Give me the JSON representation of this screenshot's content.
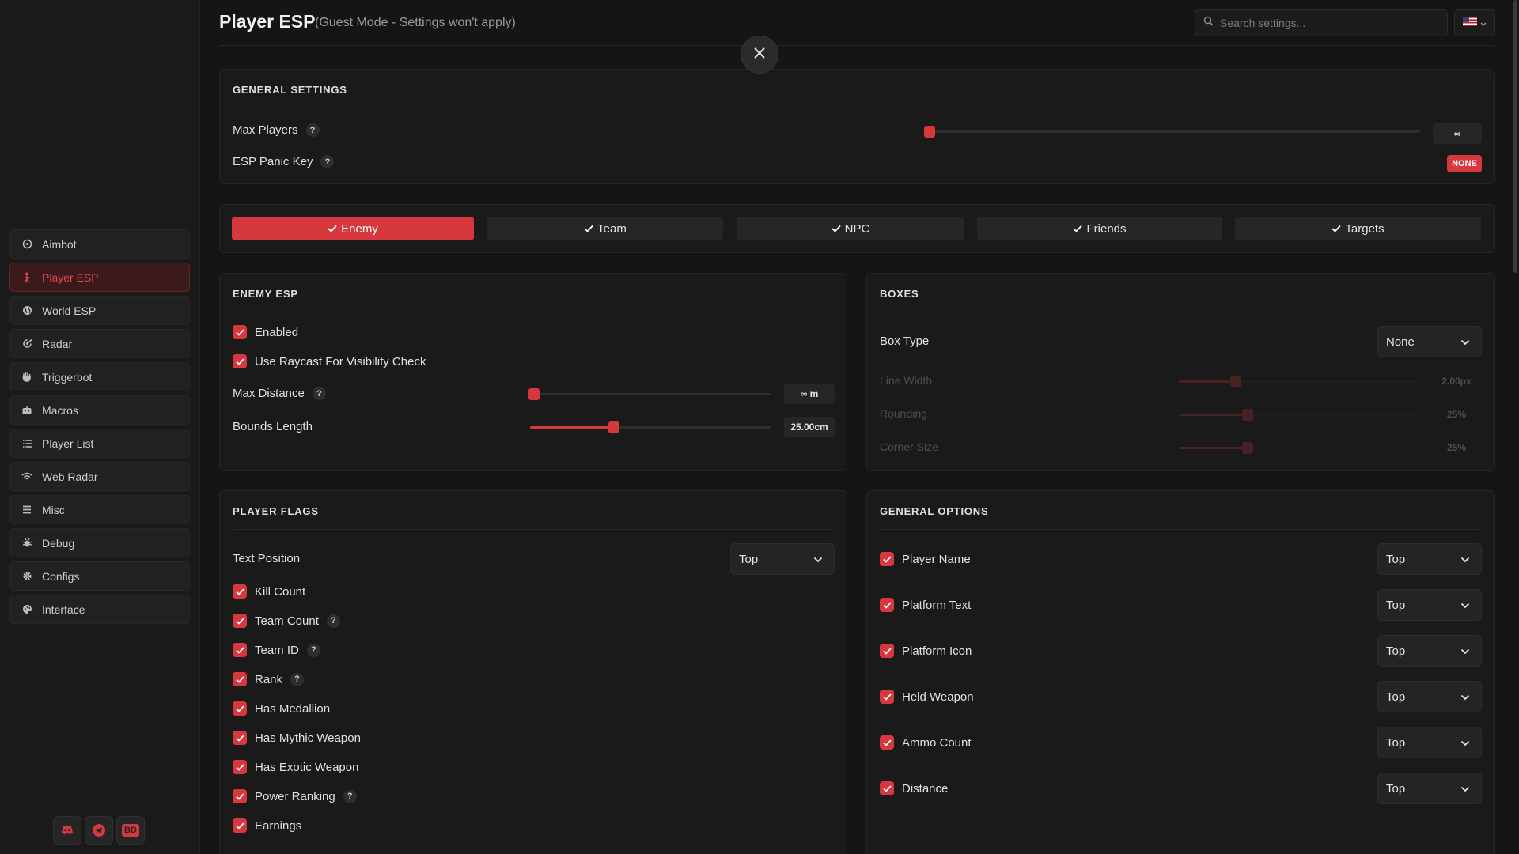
{
  "header": {
    "title": "Player ESP",
    "subtitle": "(Guest Mode - Settings won't apply)",
    "search_placeholder": "Search settings..."
  },
  "sidebar": {
    "items": [
      {
        "label": "Aimbot",
        "icon": "crosshair-icon",
        "active": false
      },
      {
        "label": "Player ESP",
        "icon": "person-icon",
        "active": true
      },
      {
        "label": "World ESP",
        "icon": "globe-icon",
        "active": false
      },
      {
        "label": "Radar",
        "icon": "radar-icon",
        "active": false
      },
      {
        "label": "Triggerbot",
        "icon": "hand-icon",
        "active": false
      },
      {
        "label": "Macros",
        "icon": "robot-icon",
        "active": false
      },
      {
        "label": "Player List",
        "icon": "list-icon",
        "active": false
      },
      {
        "label": "Web Radar",
        "icon": "wifi-icon",
        "active": false
      },
      {
        "label": "Misc",
        "icon": "menu-icon",
        "active": false
      },
      {
        "label": "Debug",
        "icon": "bug-icon",
        "active": false
      },
      {
        "label": "Configs",
        "icon": "gear-icon",
        "active": false
      },
      {
        "label": "Interface",
        "icon": "palette-icon",
        "active": false
      }
    ],
    "social": {
      "icons": [
        "discord-icon",
        "telegram-icon",
        "bd-icon"
      ],
      "bd_label": "BD"
    }
  },
  "general_settings": {
    "title": "GENERAL SETTINGS",
    "max_players": {
      "label": "Max Players",
      "help": "?",
      "value_text": "∞",
      "fraction": 0.0
    },
    "panic_key": {
      "label": "ESP Panic Key",
      "help": "?",
      "value": "NONE"
    }
  },
  "tabs": [
    {
      "label": "Enemy",
      "active": true
    },
    {
      "label": "Team",
      "active": false
    },
    {
      "label": "NPC",
      "active": false
    },
    {
      "label": "Friends",
      "active": false
    },
    {
      "label": "Targets",
      "active": false
    }
  ],
  "enemy_esp": {
    "title": "ENEMY ESP",
    "enabled": {
      "label": "Enabled",
      "checked": true
    },
    "raycast": {
      "label": "Use Raycast For Visibility Check",
      "checked": true
    },
    "max_distance": {
      "label": "Max Distance",
      "help": "?",
      "value_text": "∞ m",
      "fraction": 0.0
    },
    "bounds_length": {
      "label": "Bounds Length",
      "value_text": "25.00cm",
      "fraction": 0.33
    }
  },
  "boxes": {
    "title": "BOXES",
    "box_type": {
      "label": "Box Type",
      "value": "None"
    },
    "line_width": {
      "label": "Line Width",
      "value_text": "2.00px",
      "fraction": 0.22
    },
    "rounding": {
      "label": "Rounding",
      "value_text": "25%",
      "fraction": 0.27
    },
    "corner_size": {
      "label": "Corner Size",
      "value_text": "25%",
      "fraction": 0.27
    }
  },
  "player_flags": {
    "title": "PLAYER FLAGS",
    "text_position": {
      "label": "Text Position",
      "value": "Top"
    },
    "flags": [
      {
        "label": "Kill Count",
        "help": false,
        "checked": true
      },
      {
        "label": "Team Count",
        "help": true,
        "checked": true
      },
      {
        "label": "Team ID",
        "help": true,
        "checked": true
      },
      {
        "label": "Rank",
        "help": true,
        "checked": true
      },
      {
        "label": "Has Medallion",
        "help": false,
        "checked": true
      },
      {
        "label": "Has Mythic Weapon",
        "help": false,
        "checked": true
      },
      {
        "label": "Has Exotic Weapon",
        "help": false,
        "checked": true
      },
      {
        "label": "Power Ranking",
        "help": true,
        "checked": true
      },
      {
        "label": "Earnings",
        "help": false,
        "checked": true
      }
    ],
    "help_text": "?"
  },
  "general_options": {
    "title": "GENERAL OPTIONS",
    "options": [
      {
        "label": "Player Name",
        "value": "Top",
        "checked": true
      },
      {
        "label": "Platform Text",
        "value": "Top",
        "checked": true
      },
      {
        "label": "Platform Icon",
        "value": "Top",
        "checked": true
      },
      {
        "label": "Held Weapon",
        "value": "Top",
        "checked": true
      },
      {
        "label": "Ammo Count",
        "value": "Top",
        "checked": true
      },
      {
        "label": "Distance",
        "value": "Top",
        "checked": true
      }
    ]
  },
  "colors": {
    "accent": "#d6383e",
    "background": "#151515",
    "panel": "#1a1a1a"
  }
}
